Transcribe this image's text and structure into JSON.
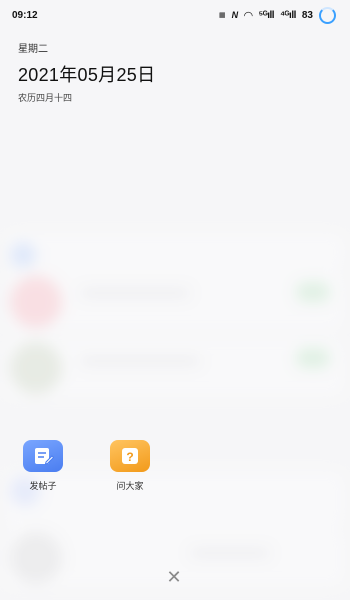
{
  "status_bar": {
    "time": "09:12",
    "battery": "83",
    "signal_1": "⁵ᴳıll",
    "signal_2": "⁴ᴳıll"
  },
  "date_widget": {
    "weekday": "星期二",
    "date": "2021年05月25日",
    "lunar": "农历四月十四"
  },
  "actions": {
    "post_label": "发帖子",
    "ask_label": "问大家"
  },
  "colors": {
    "post_accent": "#4a7df0",
    "ask_accent": "#f29a1a",
    "battery_ring": "#3aa0ff"
  }
}
